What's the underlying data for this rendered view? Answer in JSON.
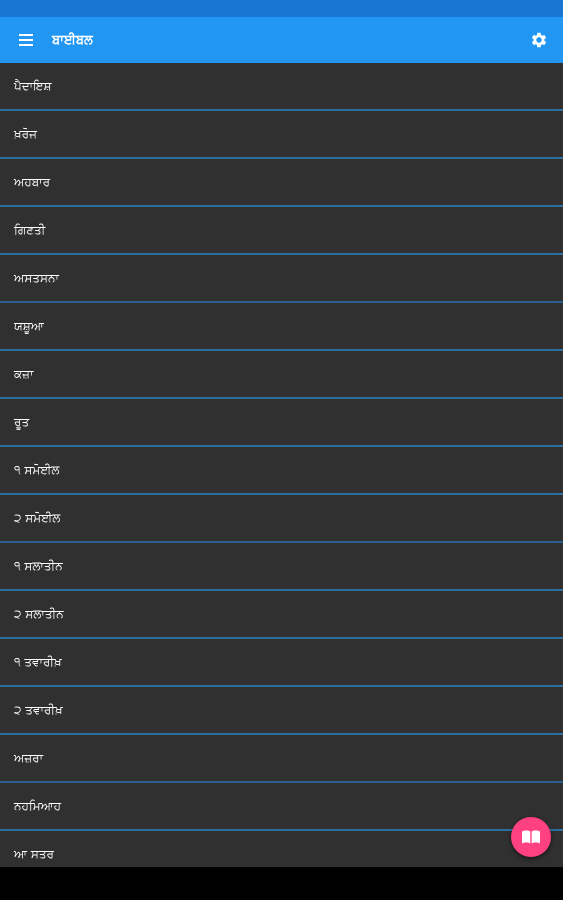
{
  "app_bar": {
    "title": "ਬਾਈਬਲ",
    "menu_icon": "menu-icon",
    "settings_icon": "gear-icon",
    "color": "#2196f3"
  },
  "books": [
    "ਪੈਦਾਇਸ਼",
    "ਖ਼ਰੋਜ",
    "ਅਹਬਾਰ",
    "ਗਿਣਤੀ",
    "ਅਸਤਸਨਾ",
    "ਯਸ਼ੂਆ",
    "ਕਜ਼ਾ",
    "ਰੂਤ",
    "੧ ਸਮੋਈਲ",
    "੨ ਸਮੋਈਲ",
    "੧ ਸਲਾਤੀਨ",
    "੨ ਸਲਾਤੀਨ",
    "੧ ਤਵਾਰੀਖ਼",
    "੨ ਤਵਾਰੀਖ਼",
    "ਅਜ਼ਰਾ",
    "ਨਹਮਿਆਹ",
    "ਆ ਸਤਰ"
  ],
  "fab": {
    "icon": "open-book-icon",
    "color": "#ff4081"
  }
}
